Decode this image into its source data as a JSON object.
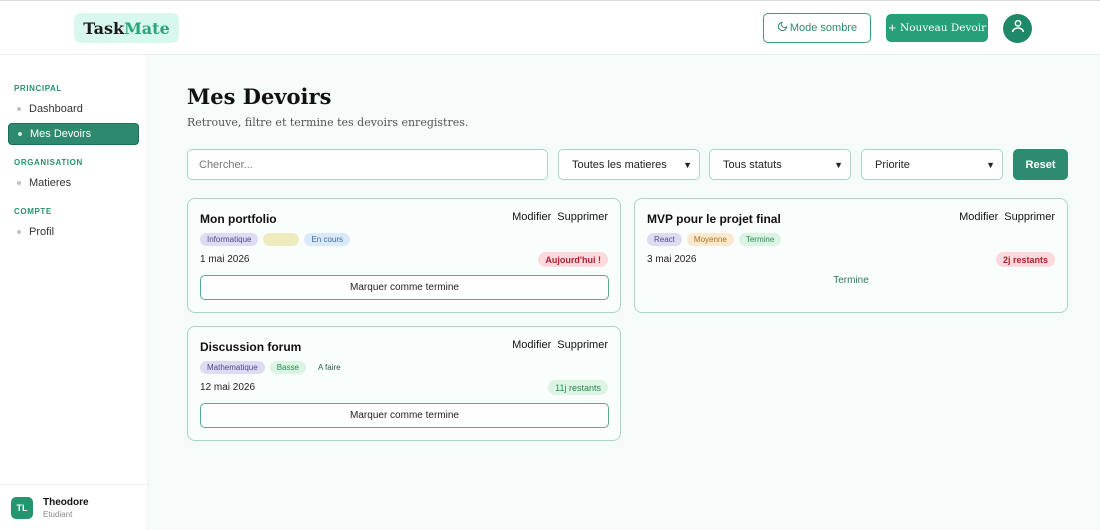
{
  "app": {
    "logo_part1": "Task",
    "logo_part2": "Mate"
  },
  "header": {
    "dark_mode_label": "Mode sombre",
    "new_homework_label": "+ Nouveau Devoir"
  },
  "sidebar": {
    "sections": [
      {
        "title": "PRINCIPAL",
        "items": [
          {
            "label": "Dashboard"
          },
          {
            "label": "Mes Devoirs"
          }
        ]
      },
      {
        "title": "ORGANISATION",
        "items": [
          {
            "label": "Matieres"
          }
        ]
      },
      {
        "title": "COMPTE",
        "items": [
          {
            "label": "Profil"
          }
        ]
      }
    ],
    "active_item": "Mes Devoirs",
    "user": {
      "initials": "TL",
      "name": "Theodore",
      "role": "Etudiant"
    }
  },
  "main": {
    "title": "Mes Devoirs",
    "subtitle": "Retrouve, filtre et termine tes devoirs enregistres.",
    "filters": {
      "search_placeholder": "Chercher...",
      "subject_select": "Toutes les matieres",
      "status_select": "Tous statuts",
      "priority_select": "Priorite",
      "reset_label": "Reset"
    },
    "card_actions": {
      "edit": "Modifier",
      "delete": "Supprimer"
    },
    "cards": [
      {
        "title": "Mon portfolio",
        "subject": "Informatique",
        "priority": "",
        "status": "En cours",
        "date": "1 mai 2026",
        "due_badge": "Aujourd'hui !",
        "action": "Marquer comme termine"
      },
      {
        "title": "MVP pour le projet final",
        "subject": "React",
        "priority": "Moyenne",
        "status": "Termine",
        "date": "3 mai 2026",
        "due_badge": "2j restants",
        "done_label": "Termine"
      },
      {
        "title": "Discussion forum",
        "subject": "Mathematique",
        "priority": "Basse",
        "status": "A faire",
        "date": "12 mai 2026",
        "due_badge": "11j restants",
        "action": "Marquer comme termine"
      }
    ]
  },
  "colors": {
    "brand": "#27a07a",
    "brand_dark": "#2e8a70",
    "background": "#f4fbf9"
  },
  "icons": {
    "dark_mode": "moon-icon",
    "profile": "user-icon",
    "select": "chevron-down-icon"
  }
}
